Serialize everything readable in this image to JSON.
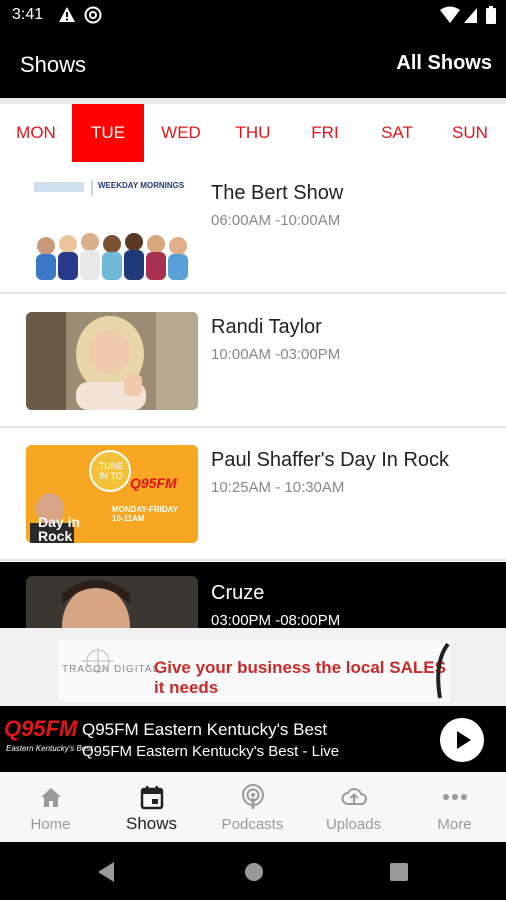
{
  "status": {
    "time": "3:41"
  },
  "appbar": {
    "title": "Shows",
    "all_shows": "All Shows"
  },
  "days": [
    "MON",
    "TUE",
    "WED",
    "THU",
    "FRI",
    "SAT",
    "SUN"
  ],
  "active_day": "TUE",
  "shows": [
    {
      "name": "The Bert Show",
      "time": "06:00AM -10:00AM",
      "thumb_text": "WEEKDAY MORNINGS"
    },
    {
      "name": "Randi Taylor",
      "time": "10:00AM -03:00PM"
    },
    {
      "name": "Paul Shaffer's Day In Rock",
      "time": "10:25AM - 10:30AM",
      "thumb_text": "TUNE IN TO",
      "thumb_brand": "Q95FM",
      "thumb_sched": "MONDAY-FRIDAY 10-11AM",
      "thumb_title": "Day in Rock"
    },
    {
      "name": "Cruze",
      "time": "03:00PM -08:00PM"
    }
  ],
  "ad": {
    "brand": "TRACON DIGITAL",
    "tagline": "Give your business the local SALES it needs"
  },
  "player": {
    "logo": "Q95FM",
    "logo_sub": "Eastern Kentucky's Best",
    "station": "Q95FM Eastern Kentucky's Best",
    "subtitle": "Q95FM Eastern Kentucky's Best - Live"
  },
  "tabs": [
    {
      "label": "Home",
      "icon": "home-icon"
    },
    {
      "label": "Shows",
      "icon": "calendar-icon"
    },
    {
      "label": "Podcasts",
      "icon": "podcast-icon"
    },
    {
      "label": "Uploads",
      "icon": "upload-icon"
    },
    {
      "label": "More",
      "icon": "more-icon"
    }
  ],
  "colors": {
    "accent": "#ff0000",
    "day_text": "#e0161b",
    "bar": "#000000"
  }
}
